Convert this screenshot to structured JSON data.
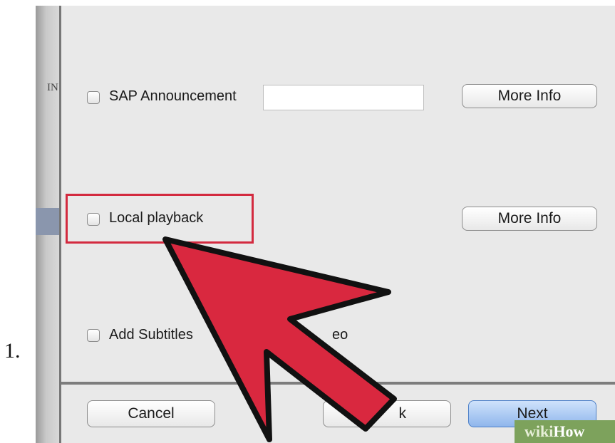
{
  "list_marker": "1.",
  "sidebar": {
    "partial_label": "IN"
  },
  "options": [
    {
      "label": "SAP Announcement",
      "checked": false,
      "more_info": "More Info"
    },
    {
      "label": "Local playback",
      "checked": false,
      "more_info": "More Info"
    },
    {
      "label_visible_start": "Add Subtitles",
      "label_visible_end": "eo",
      "checked": false
    }
  ],
  "sap_announcement_input": {
    "value": ""
  },
  "footer": {
    "cancel": "Cancel",
    "back_visible": "k",
    "next": "Next"
  },
  "annotation": {
    "arrow_color": "#d9283f",
    "highlight_color": "#d32a3f"
  },
  "watermark": {
    "part1": "wiki",
    "part2": "How"
  }
}
